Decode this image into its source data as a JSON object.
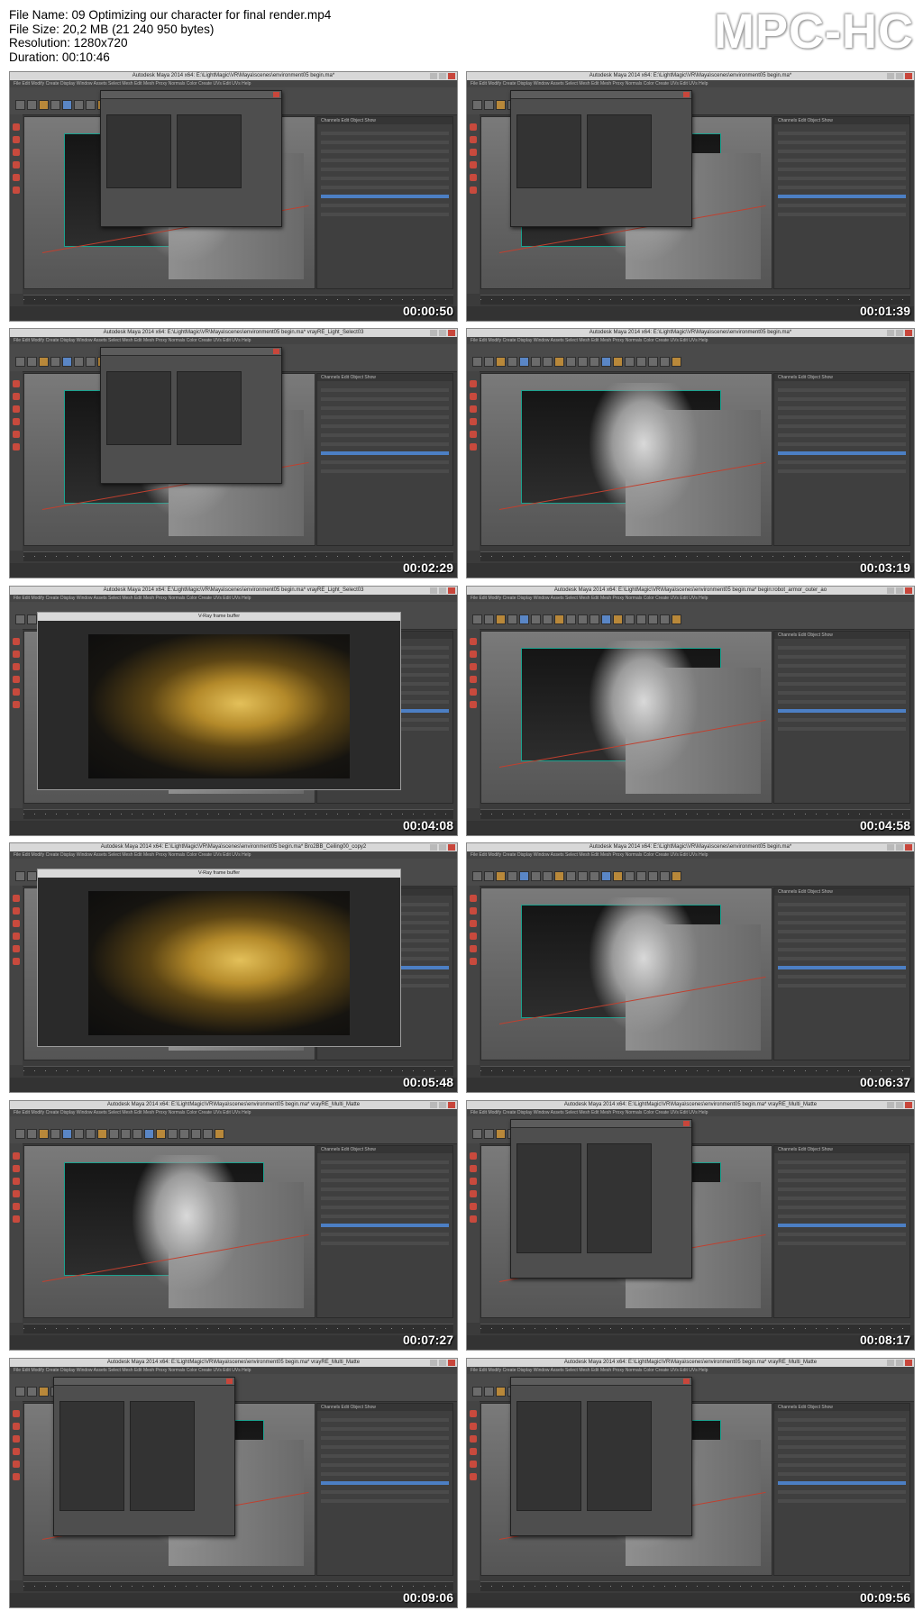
{
  "info": {
    "file_name": "File Name: 09 Optimizing our character for final render.mp4",
    "file_size": "File Size: 20,2 MB (21 240 950 bytes)",
    "resolution": "Resolution: 1280x720",
    "duration": "Duration: 00:10:46"
  },
  "logo": "MPC-HC",
  "thumbnails": [
    {
      "timestamp": "00:00:50",
      "title": "Autodesk Maya 2014 x64: E:\\LightMagic\\VR\\Maya\\scenes\\environment05 begin.ma*",
      "scene": "dialog"
    },
    {
      "timestamp": "00:01:39",
      "title": "Autodesk Maya 2014 x64: E:\\LightMagic\\VR\\Maya\\scenes\\environment05 begin.ma*",
      "scene": "dialog"
    },
    {
      "timestamp": "00:02:29",
      "title": "Autodesk Maya 2014 x64: E:\\LightMagic\\VR\\Maya\\scenes\\environment05 begin.ma*    vrayRE_Light_Select03",
      "scene": "dialog"
    },
    {
      "timestamp": "00:03:19",
      "title": "Autodesk Maya 2014 x64: E:\\LightMagic\\VR\\Maya\\scenes\\environment05 begin.ma*",
      "scene": "viewport"
    },
    {
      "timestamp": "00:04:08",
      "title": "Autodesk Maya 2014 x64: E:\\LightMagic\\VR\\Maya\\scenes\\environment05 begin.ma*    vrayRE_Light_Select03",
      "scene": "render"
    },
    {
      "timestamp": "00:04:58",
      "title": "Autodesk Maya 2014 x64: E:\\LightMagic\\VR\\Maya\\scenes\\environment05 begin.ma*    begin:robot_armor_outer_ao",
      "scene": "viewport"
    },
    {
      "timestamp": "00:05:48",
      "title": "Autodesk Maya 2014 x64: E:\\LightMagic\\VR\\Maya\\scenes\\environment05 begin.ma*    Bro2BB_Ceiling00_copy2",
      "scene": "render"
    },
    {
      "timestamp": "00:06:37",
      "title": "Autodesk Maya 2014 x64: E:\\LightMagic\\VR\\Maya\\scenes\\environment05 begin.ma*",
      "scene": "viewport"
    },
    {
      "timestamp": "00:07:27",
      "title": "Autodesk Maya 2014 x64: E:\\LightMagic\\VR\\Maya\\scenes\\environment05 begin.ma*    vrayRE_Multi_Matte",
      "scene": "viewport"
    },
    {
      "timestamp": "00:08:17",
      "title": "Autodesk Maya 2014 x64: E:\\LightMagic\\VR\\Maya\\scenes\\environment05 begin.ma*    vrayRE_Multi_Matte",
      "scene": "dialog"
    },
    {
      "timestamp": "00:09:06",
      "title": "Autodesk Maya 2014 x64: E:\\LightMagic\\VR\\Maya\\scenes\\environment05 begin.ma*    vrayRE_Multi_Matte",
      "scene": "dialog"
    },
    {
      "timestamp": "00:09:56",
      "title": "Autodesk Maya 2014 x64: E:\\LightMagic\\VR\\Maya\\scenes\\environment05 begin.ma*    vrayRE_Multi_Matte",
      "scene": "dialog"
    }
  ]
}
